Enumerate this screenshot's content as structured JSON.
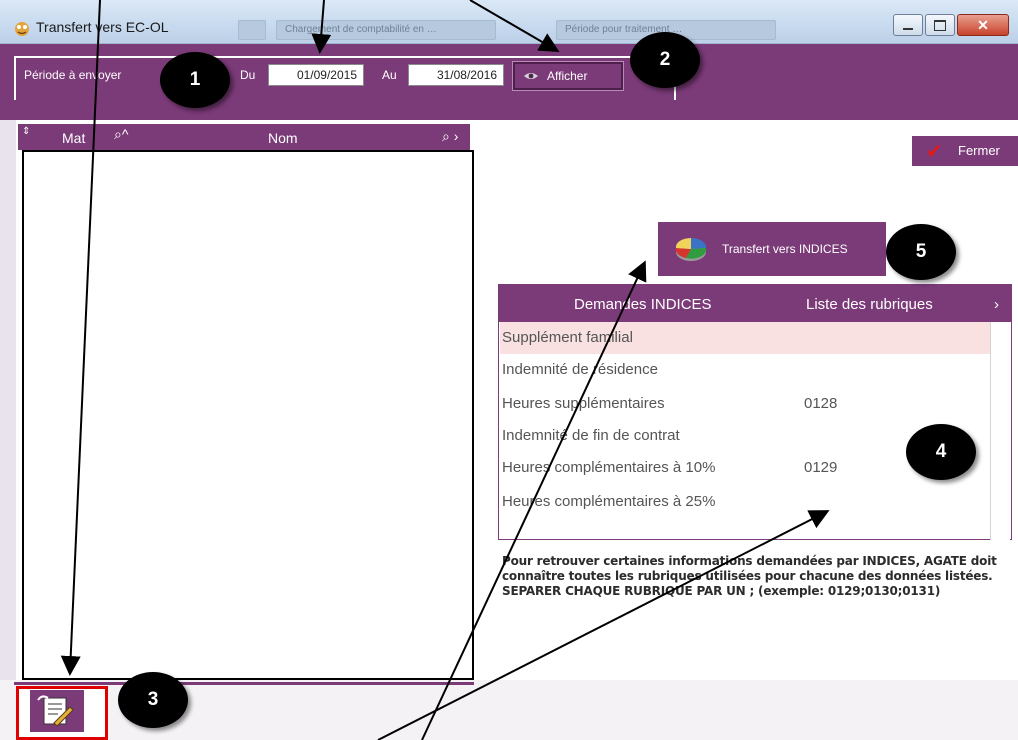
{
  "window": {
    "title": "Transfert vers EC-OL",
    "background_tabs": [
      "Chargement de comptabilité en …",
      "Période pour traitement …"
    ],
    "buttons": [
      "minimize-icon",
      "maximize-icon",
      "close-icon"
    ]
  },
  "filter": {
    "period_label": "Période à envoyer",
    "du_label": "Du",
    "date_from": "01/09/2015",
    "au_label": "Au",
    "date_to": "31/08/2016",
    "afficher_label": "Afficher"
  },
  "left_list": {
    "columns": [
      "Mat",
      "Nom"
    ]
  },
  "fermer_label": "Fermer",
  "transfert_label": "Transfert vers INDICES",
  "rubriques": {
    "col_demandes": "Demandes INDICES",
    "col_liste": "Liste des rubriques",
    "rows": [
      {
        "name": "Supplément familial",
        "code": ""
      },
      {
        "name": "Indemnité de résidence",
        "code": ""
      },
      {
        "name": "Heures supplémentaires",
        "code": "0128"
      },
      {
        "name": "Indemnité de fin de contrat",
        "code": ""
      },
      {
        "name": "Heures complémentaires à 10%",
        "code": "0129"
      },
      {
        "name": "Heures complémentaires à 25%",
        "code": ""
      }
    ]
  },
  "info_text": "Pour retrouver certaines informations demandées par INDICES, AGATE doit connaître toutes les rubriques utilisées pour chacune des données listées. SEPARER CHAQUE RUBRIQUE PAR UN ; (exemple: 0129;0130;0131)",
  "badges": [
    "1",
    "2",
    "3",
    "4",
    "5"
  ],
  "colors": {
    "accent": "#7b3a78",
    "selected_row": "#f9e1e2",
    "callout_red": "#e00000"
  }
}
